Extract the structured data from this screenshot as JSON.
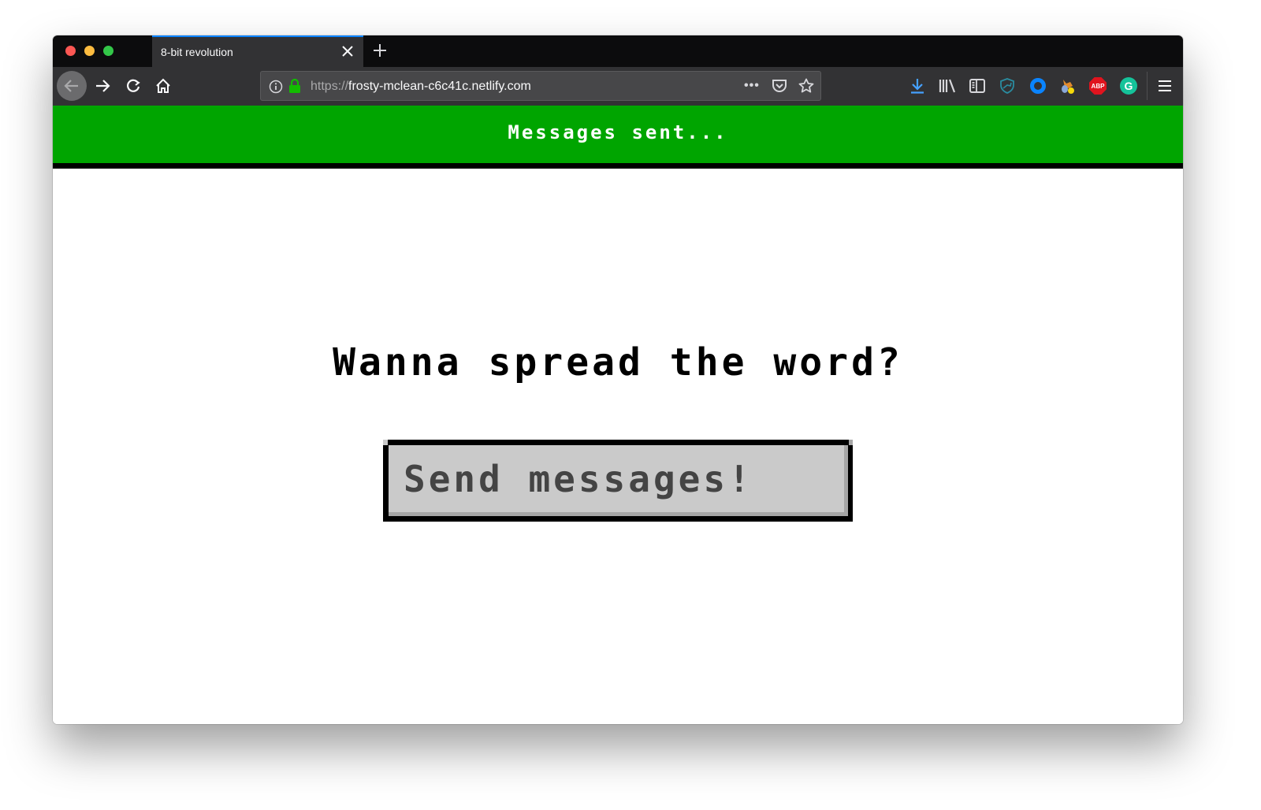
{
  "browser": {
    "tab": {
      "title": "8-bit revolution",
      "close_icon": "close-icon"
    },
    "new_tab_icon": "plus-icon",
    "nav": {
      "back_icon": "arrow-left-icon",
      "forward_icon": "arrow-right-icon",
      "reload_icon": "reload-icon",
      "home_icon": "home-icon"
    },
    "url": {
      "scheme": "https://",
      "host": "frosty-mclean-c6c41c.netlify.com",
      "info_icon": "info-icon",
      "lock_icon": "lock-icon",
      "page_actions_label": "•••",
      "pocket_icon": "pocket-icon",
      "bookmark_icon": "star-icon"
    },
    "toolbar": {
      "download_icon": "download-icon",
      "library_icon": "library-icon",
      "sidebar_icon": "sidebar-icon",
      "shield_icon": "shield-icon",
      "circle_icon": "circle-extension-icon",
      "fox_icon": "fox-extension-icon",
      "abp_label": "ABP",
      "grammarly_label": "G",
      "menu_icon": "hamburger-menu-icon"
    },
    "colors": {
      "accent_tab": "#0a84ff",
      "lock_green": "#12bc00",
      "download_blue": "#45a1ff"
    }
  },
  "page": {
    "banner": {
      "text": "Messages sent...",
      "color": "#00a500"
    },
    "headline": "Wanna spread the word?",
    "send_button": {
      "label": "Send messages!"
    }
  }
}
